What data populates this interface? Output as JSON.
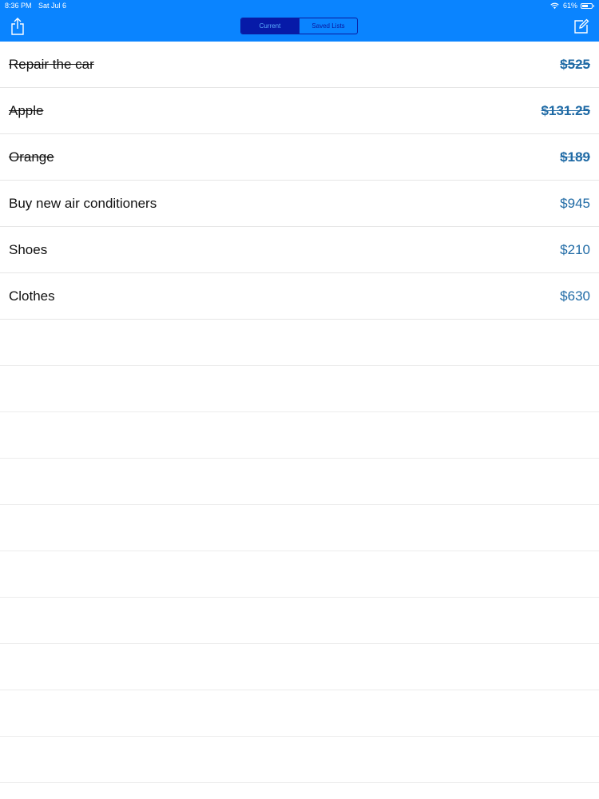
{
  "status_bar": {
    "time": "8:36 PM",
    "date": "Sat Jul 6",
    "battery_percent_text": "61%",
    "battery_level": 0.61
  },
  "nav": {
    "share_icon": "share-icon",
    "compose_icon": "compose-icon",
    "segments": [
      {
        "label": "Current",
        "selected": true
      },
      {
        "label": "Saved Lists",
        "selected": false
      }
    ]
  },
  "items": [
    {
      "name": "Repair the car",
      "price": "$525",
      "completed": true
    },
    {
      "name": "Apple",
      "price": "$131.25",
      "completed": true
    },
    {
      "name": "Orange",
      "price": "$189",
      "completed": true
    },
    {
      "name": "Buy new air conditioners",
      "price": "$945",
      "completed": false
    },
    {
      "name": "Shoes",
      "price": "$210",
      "completed": false
    },
    {
      "name": "Clothes",
      "price": "$630",
      "completed": false
    }
  ],
  "colors": {
    "nav_background": "#0a84ff",
    "segment_selected": "#061aa8",
    "price_text": "#1f6aa5"
  }
}
